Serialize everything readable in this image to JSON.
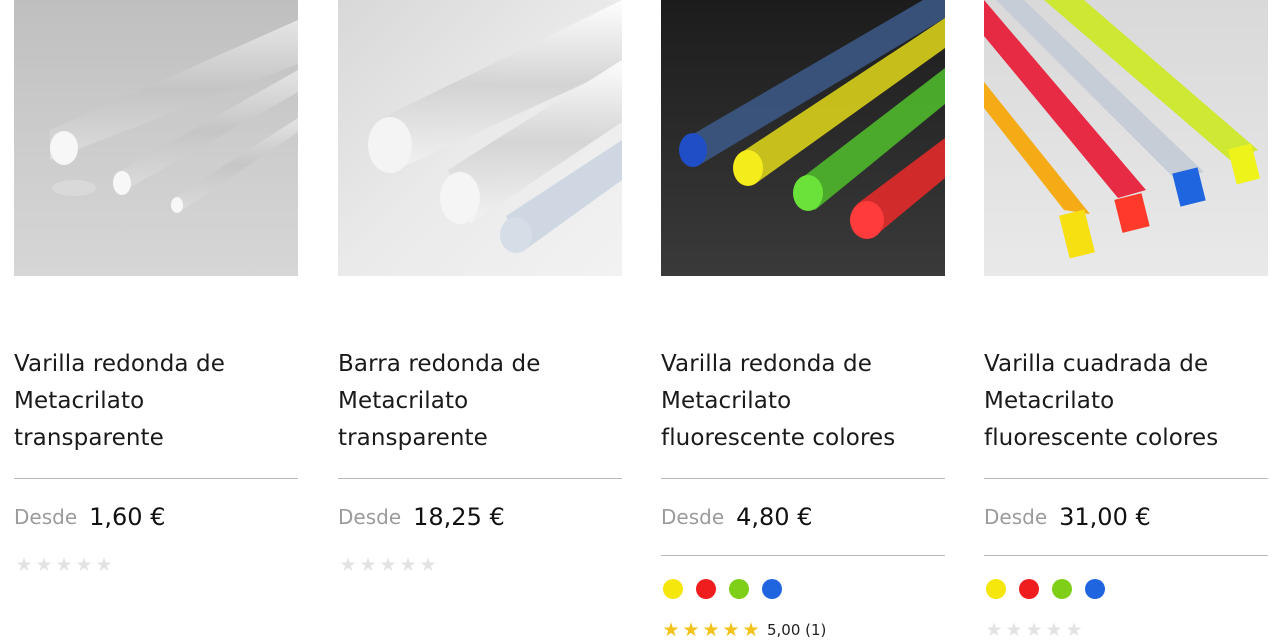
{
  "products": [
    {
      "title_lines": [
        "Varilla redonda de",
        "Metacrilato",
        "transparente"
      ],
      "price_prefix": "Desde",
      "price": "1,60 €",
      "rating": 0,
      "rating_text": "",
      "swatches": []
    },
    {
      "title_lines": [
        "Barra redonda de",
        "Metacrilato",
        "transparente"
      ],
      "price_prefix": "Desde",
      "price": "18,25 €",
      "rating": 0,
      "rating_text": "",
      "swatches": []
    },
    {
      "title_lines": [
        "Varilla redonda de",
        "Metacrilato",
        "fluorescente colores"
      ],
      "price_prefix": "Desde",
      "price": "4,80 €",
      "rating": 5,
      "rating_text": "5,00 (1)",
      "swatches": [
        "#f5e60c",
        "#ef1d1d",
        "#7fcf18",
        "#1f65e0"
      ]
    },
    {
      "title_lines": [
        "Varilla cuadrada de",
        "Metacrilato",
        "fluorescente colores"
      ],
      "price_prefix": "Desde",
      "price": "31,00 €",
      "rating": 0,
      "rating_text": "",
      "swatches": [
        "#f5e60c",
        "#ef1d1d",
        "#7fcf18",
        "#1f65e0"
      ]
    }
  ],
  "star_glyph": "★",
  "colors": {
    "star_empty": "#e3e3e3",
    "star_filled": "#f2c21b",
    "divider": "#b9b9b9",
    "price_prefix": "#9b9b9b"
  }
}
